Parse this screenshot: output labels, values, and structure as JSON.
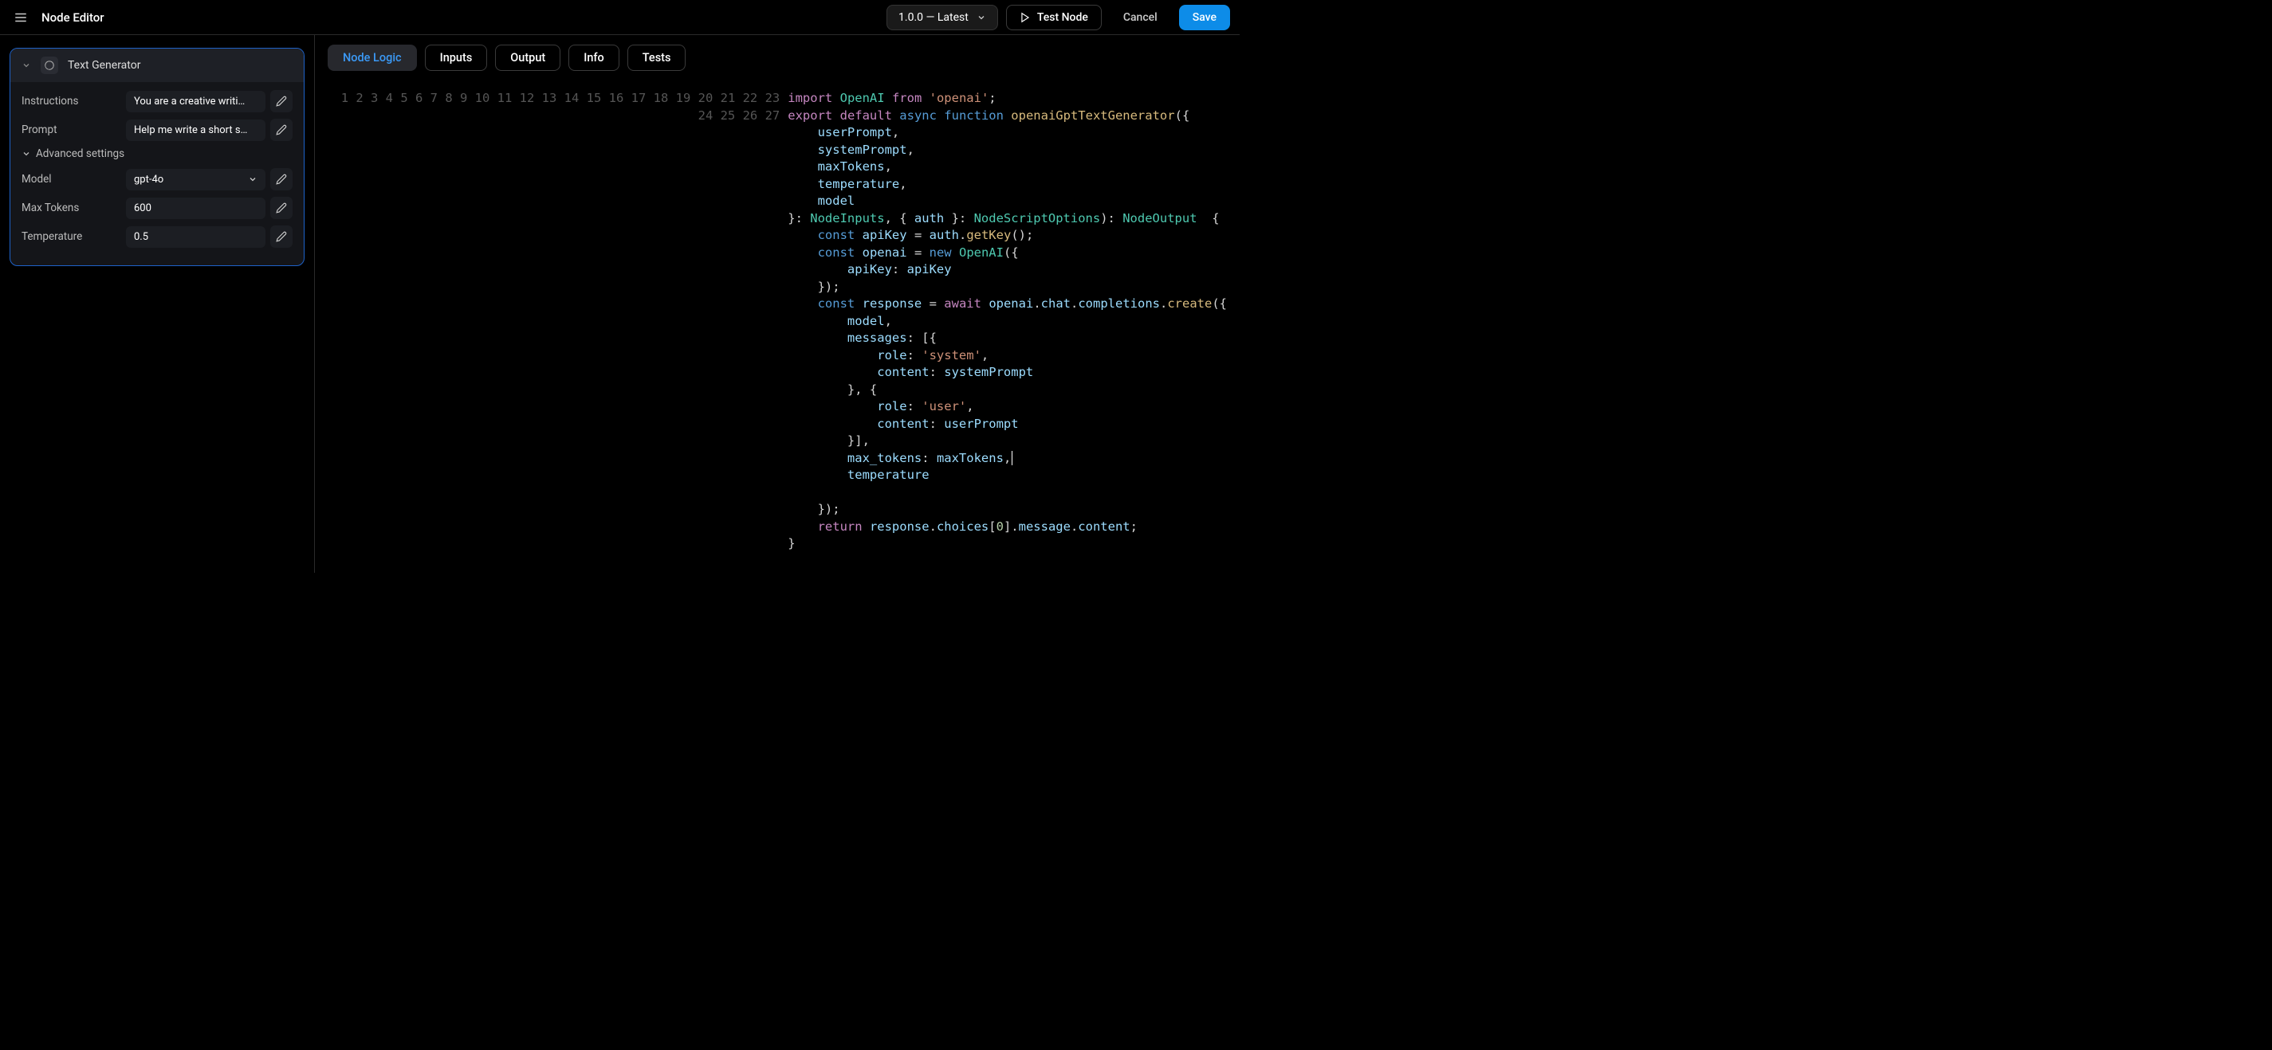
{
  "header": {
    "title": "Node Editor",
    "version": "1.0.0 — Latest",
    "test_label": "Test Node",
    "cancel_label": "Cancel",
    "save_label": "Save"
  },
  "sidebar": {
    "node": {
      "title": "Text Generator",
      "fields": {
        "instructions_label": "Instructions",
        "instructions_value": "You are a creative writi…",
        "prompt_label": "Prompt",
        "prompt_value": "Help me write a short s…",
        "advanced_label": "Advanced settings",
        "model_label": "Model",
        "model_value": "gpt-4o",
        "max_tokens_label": "Max Tokens",
        "max_tokens_value": "600",
        "temperature_label": "Temperature",
        "temperature_value": "0.5"
      }
    }
  },
  "tabs": {
    "node_logic": "Node Logic",
    "inputs": "Inputs",
    "output": "Output",
    "info": "Info",
    "tests": "Tests"
  },
  "code": {
    "line_count": 27,
    "tokens": {
      "import": "import",
      "OpenAI": "OpenAI",
      "from": "from",
      "openai_str": "'openai'",
      "export": "export",
      "default": "default",
      "async": "async",
      "function": "function",
      "fn_name": "openaiGptTextGenerator",
      "userPrompt": "userPrompt",
      "systemPrompt": "systemPrompt",
      "maxTokens": "maxTokens",
      "temperature": "temperature",
      "model": "model",
      "NodeInputs": "NodeInputs",
      "auth": "auth",
      "NodeScriptOptions": "NodeScriptOptions",
      "NodeOutput": "NodeOutput",
      "const": "const",
      "apiKey": "apiKey",
      "getKey": "getKey",
      "openai_var": "openai",
      "new": "new",
      "response": "response",
      "await": "await",
      "chat": "chat",
      "completions": "completions",
      "create": "create",
      "messages": "messages",
      "role": "role",
      "system_str": "'system'",
      "content": "content",
      "user_str": "'user'",
      "max_tokens": "max_tokens",
      "return": "return",
      "choices": "choices",
      "zero": "0",
      "message": "message"
    }
  }
}
